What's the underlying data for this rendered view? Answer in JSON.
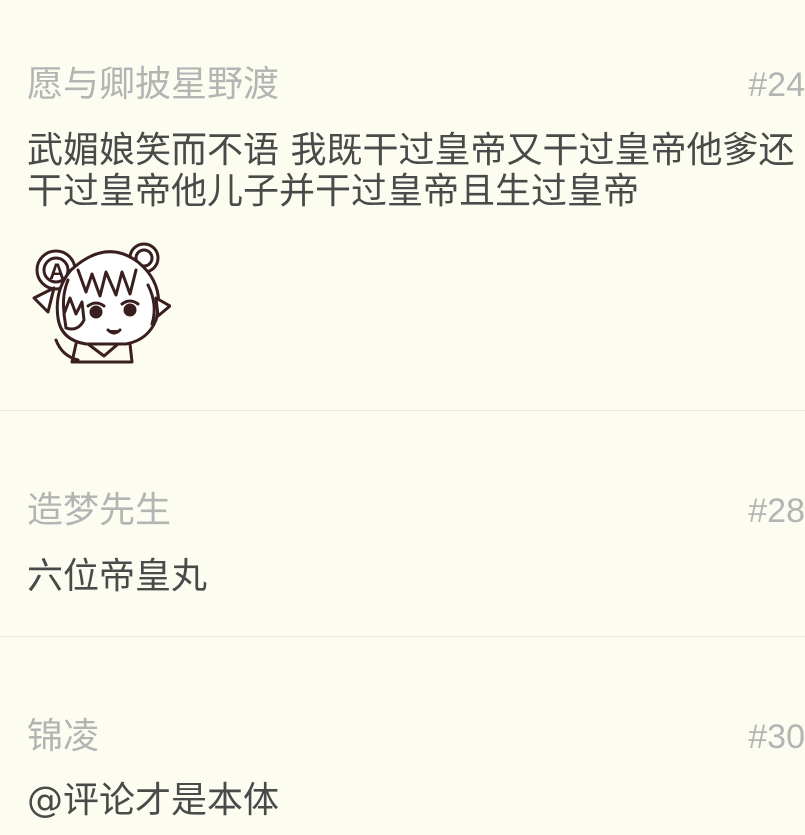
{
  "comments": [
    {
      "username": "愿与卿披星野渡",
      "floor": "#24",
      "text": "武媚娘笑而不语 我既干过皇帝又干过皇帝他爹还干过皇帝他儿子并干过皇帝且生过皇帝",
      "sticker": "anime-girl-sticker"
    },
    {
      "username": "造梦先生",
      "floor": "#28",
      "text": "六位帝皇丸"
    },
    {
      "username": "锦凌",
      "floor": "#30",
      "text": "@评论才是本体"
    }
  ],
  "colors": {
    "background": "#fdfcf1",
    "username": "#b4b4b4",
    "text": "#4a4a4a",
    "divider": "#e9e7dc"
  }
}
